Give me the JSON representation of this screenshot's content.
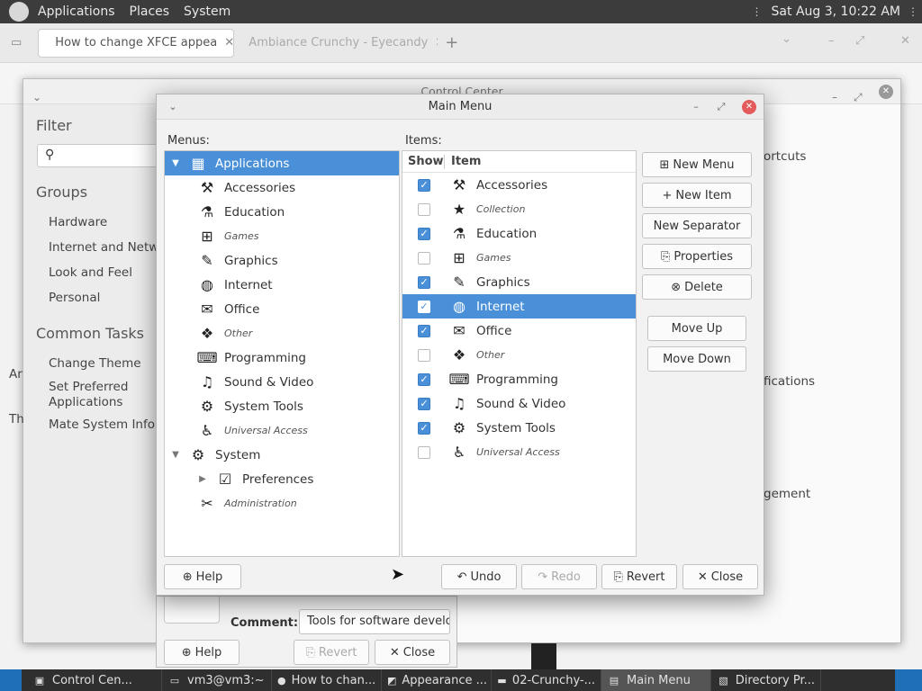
{
  "top_panel": {
    "menus": [
      "Applications",
      "Places",
      "System"
    ],
    "clock": "Sat Aug  3, 10:22 AM"
  },
  "browser": {
    "tabs": [
      "How to change XFCE appea",
      "Ambiance Crunchy - Eyecandy"
    ]
  },
  "control_center": {
    "title": "Control Center",
    "filter_label": "Filter",
    "groups_label": "Groups",
    "groups": [
      "Hardware",
      "Internet and Network",
      "Look and Feel",
      "Personal"
    ],
    "tasks_label": "Common Tasks",
    "tasks": [
      "Change Theme",
      "Set Preferred Applications",
      "Mate System Info"
    ],
    "right_fragments": [
      "ortcuts",
      "fications",
      "gement"
    ],
    "left_fragments": [
      "Ar",
      "Th"
    ]
  },
  "main_menu": {
    "title": "Main Menu",
    "menus_label": "Menus:",
    "items_label": "Items:",
    "col_show": "Show",
    "col_item": "Item",
    "menus_tree": [
      {
        "label": "Applications",
        "icon": "applications-icon",
        "glyph": "▦",
        "expander": "▼",
        "level": 0,
        "selected": true,
        "hidden": false
      },
      {
        "label": "Accessories",
        "icon": "accessories-icon",
        "glyph": "⚒",
        "level": 1,
        "hidden": false
      },
      {
        "label": "Education",
        "icon": "education-flask-icon",
        "glyph": "⚗",
        "level": 1,
        "hidden": false
      },
      {
        "label": "Games",
        "icon": "games-gamepad-icon",
        "glyph": "⊞",
        "level": 1,
        "hidden": true
      },
      {
        "label": "Graphics",
        "icon": "graphics-palette-icon",
        "glyph": "✎",
        "level": 1,
        "hidden": false
      },
      {
        "label": "Internet",
        "icon": "internet-globe-icon",
        "glyph": "◍",
        "level": 1,
        "hidden": false
      },
      {
        "label": "Office",
        "icon": "office-icon",
        "glyph": "✉",
        "level": 1,
        "hidden": false
      },
      {
        "label": "Other",
        "icon": "other-icon",
        "glyph": "❖",
        "level": 1,
        "hidden": true
      },
      {
        "label": "Programming",
        "icon": "programming-icon",
        "glyph": "⌨",
        "level": 1,
        "hidden": false
      },
      {
        "label": "Sound & Video",
        "icon": "sound-video-icon",
        "glyph": "♫",
        "level": 1,
        "hidden": false
      },
      {
        "label": "System Tools",
        "icon": "system-tools-gear-icon",
        "glyph": "⚙",
        "level": 1,
        "hidden": false
      },
      {
        "label": "Universal Access",
        "icon": "universal-access-icon",
        "glyph": "♿",
        "level": 1,
        "hidden": true
      },
      {
        "label": "System",
        "icon": "system-icon",
        "glyph": "⚙",
        "expander": "▼",
        "level": 0,
        "hidden": false
      },
      {
        "label": "Preferences",
        "icon": "preferences-icon",
        "glyph": "☑",
        "expander": "▶",
        "level": 1,
        "hidden": false
      },
      {
        "label": "Administration",
        "icon": "administration-tools-icon",
        "glyph": "✂",
        "level": 1,
        "hidden": true
      }
    ],
    "items": [
      {
        "label": "Accessories",
        "icon": "accessories-icon",
        "glyph": "⚒",
        "show": true,
        "hidden": false
      },
      {
        "label": "Collection",
        "icon": "collection-star-icon",
        "glyph": "★",
        "show": false,
        "hidden": true
      },
      {
        "label": "Education",
        "icon": "education-flask-icon",
        "glyph": "⚗",
        "show": true,
        "hidden": false
      },
      {
        "label": "Games",
        "icon": "games-gamepad-icon",
        "glyph": "⊞",
        "show": false,
        "hidden": true
      },
      {
        "label": "Graphics",
        "icon": "graphics-palette-icon",
        "glyph": "✎",
        "show": true,
        "hidden": false
      },
      {
        "label": "Internet",
        "icon": "internet-globe-icon",
        "glyph": "◍",
        "show": true,
        "hidden": false,
        "selected": true
      },
      {
        "label": "Office",
        "icon": "office-icon",
        "glyph": "✉",
        "show": true,
        "hidden": false
      },
      {
        "label": "Other",
        "icon": "other-icon",
        "glyph": "❖",
        "show": false,
        "hidden": true
      },
      {
        "label": "Programming",
        "icon": "programming-icon",
        "glyph": "⌨",
        "show": true,
        "hidden": false
      },
      {
        "label": "Sound & Video",
        "icon": "sound-video-icon",
        "glyph": "♫",
        "show": true,
        "hidden": false
      },
      {
        "label": "System Tools",
        "icon": "system-tools-gear-icon",
        "glyph": "⚙",
        "show": true,
        "hidden": false
      },
      {
        "label": "Universal Access",
        "icon": "universal-access-icon",
        "glyph": "♿",
        "show": false,
        "hidden": true
      }
    ],
    "buttons": {
      "new_menu": "New Menu",
      "new_item": "New Item",
      "new_separator": "New Separator",
      "properties": "Properties",
      "delete": "Delete",
      "move_up": "Move Up",
      "move_down": "Move Down",
      "help": "Help",
      "undo": "Undo",
      "redo": "Redo",
      "revert": "Revert",
      "close": "Close"
    }
  },
  "under_dialog": {
    "comment_label": "Comment:",
    "comment_value": "Tools for software develo",
    "help": "Help",
    "revert": "Revert",
    "close": "Close"
  },
  "taskbar": {
    "tasks": [
      {
        "label": "Control Cen...",
        "icon": "control-center-icon",
        "glyph": "▣"
      },
      {
        "label": "vm3@vm3:~",
        "icon": "terminal-icon",
        "glyph": "▭"
      },
      {
        "label": "How to chan...",
        "icon": "firefox-icon",
        "glyph": "●"
      },
      {
        "label": "Appearance ...",
        "icon": "appearance-icon",
        "glyph": "◩"
      },
      {
        "label": "02-Crunchy-...",
        "icon": "folder-icon",
        "glyph": "▬"
      },
      {
        "label": "Main Menu",
        "icon": "main-menu-icon",
        "glyph": "▤",
        "active": true
      },
      {
        "label": "Directory Pr...",
        "icon": "directory-properties-icon",
        "glyph": "▧"
      }
    ]
  }
}
